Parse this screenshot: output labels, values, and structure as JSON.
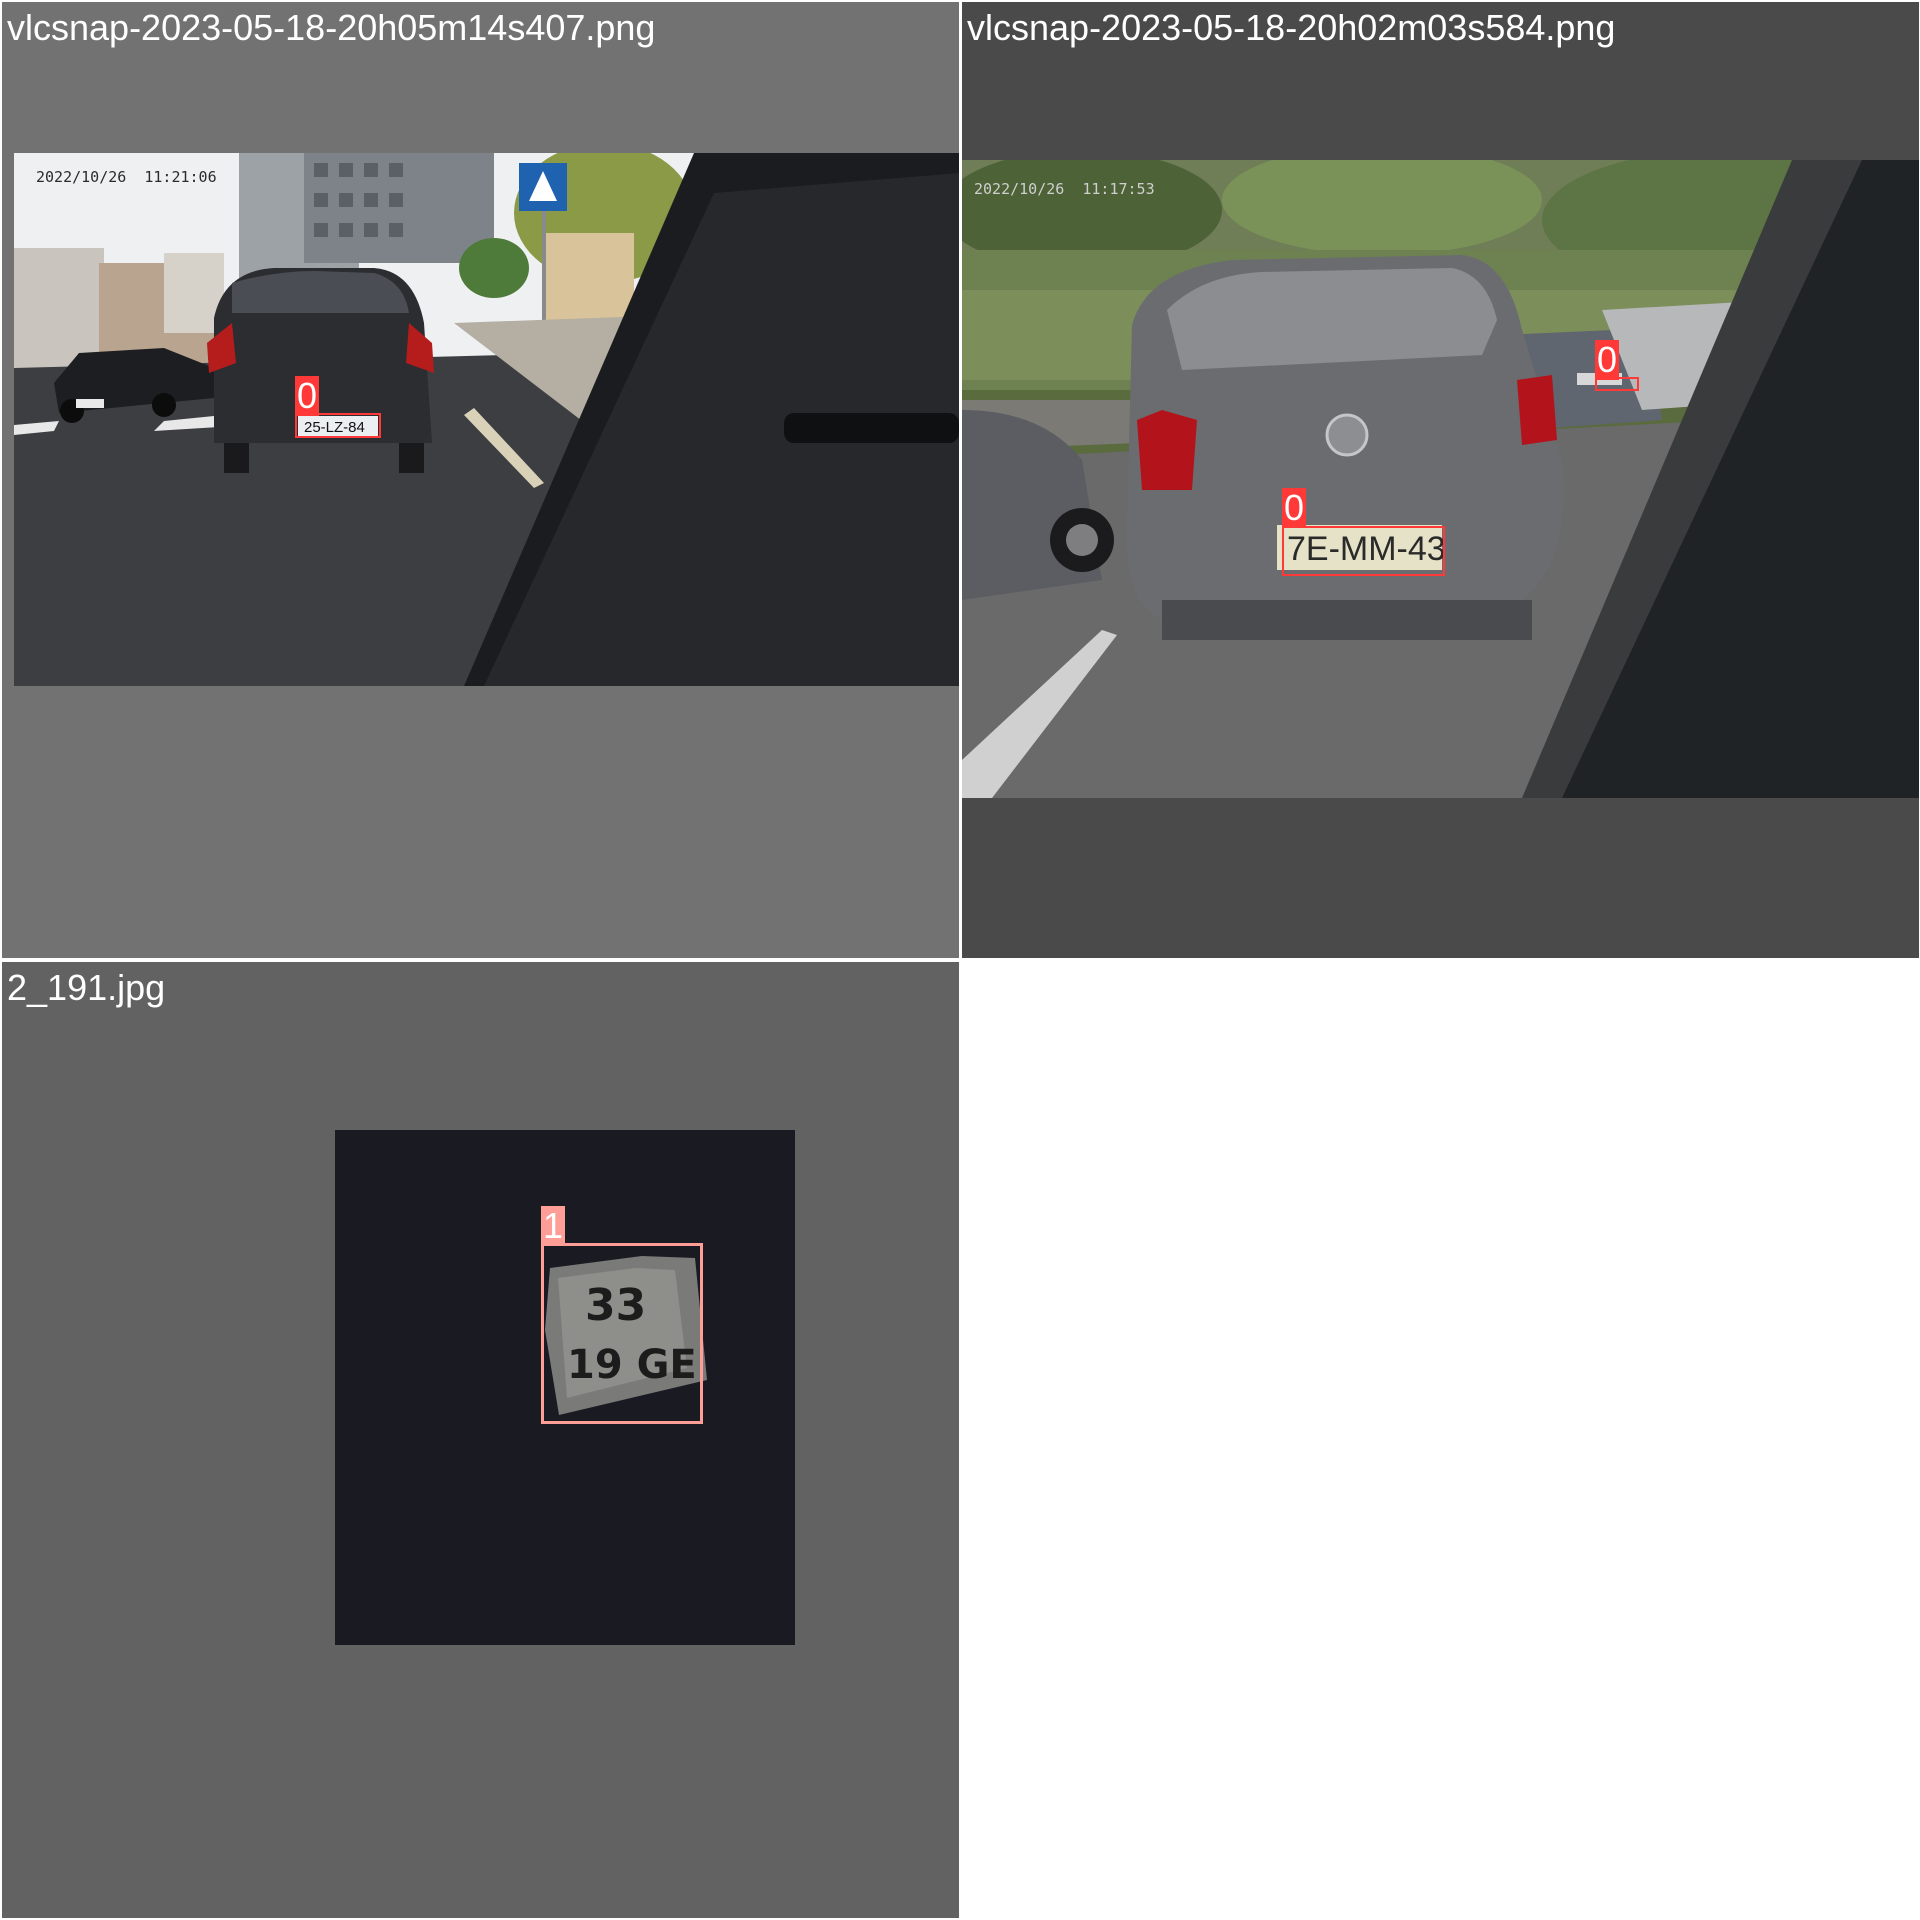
{
  "tiles": [
    {
      "filename": "vlcsnap-2023-05-18-20h05m14s407.png",
      "timestamp": "2022/10/26  11:21:06",
      "plate": "25-LZ-84",
      "detections": [
        {
          "class_id": "0"
        }
      ]
    },
    {
      "filename": "vlcsnap-2023-05-18-20h02m03s584.png",
      "timestamp": "2022/10/26  11:17:53",
      "plate": "7E-MM-43",
      "detections": [
        {
          "class_id": "0"
        },
        {
          "class_id": "0"
        }
      ]
    },
    {
      "filename": "2_191.jpg",
      "plate_line1": "33",
      "plate_line2": "19 GE",
      "detections": [
        {
          "class_id": "1"
        }
      ]
    }
  ],
  "colors": {
    "class_0": "#ff3838",
    "class_1": "#ff9d97",
    "tile1_bg": "#727272",
    "tile2_bg": "#4a4a4a",
    "tile3_bg": "#626262"
  }
}
